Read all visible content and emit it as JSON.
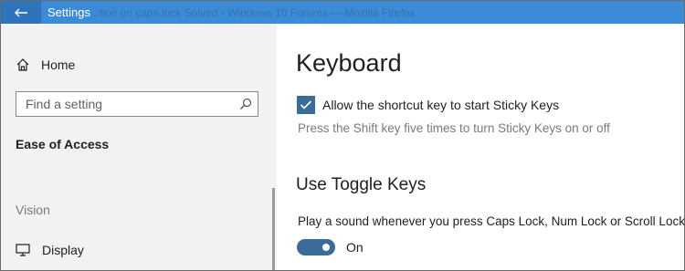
{
  "window": {
    "title": "Settings",
    "background_title": "…tion on caps lock Solved - Windows 10 Forums — Mozilla Firefox",
    "accent": "#3c8bd6"
  },
  "sidebar": {
    "home_label": "Home",
    "search_placeholder": "Find a setting",
    "section_title": "Ease of Access",
    "category_label": "Vision",
    "display_label": "Display"
  },
  "main": {
    "title": "Keyboard",
    "sticky_checkbox_label": "Allow the shortcut key to start Sticky Keys",
    "sticky_checkbox_checked": true,
    "sticky_hint": "Press the Shift key five times to turn Sticky Keys on or off",
    "toggle_heading": "Use Toggle Keys",
    "toggle_description": "Play a sound whenever you press Caps Lock, Num Lock or Scroll Lock",
    "toggle_state_label": "On",
    "toggle_on": true,
    "control_color": "#3a6c9a"
  }
}
